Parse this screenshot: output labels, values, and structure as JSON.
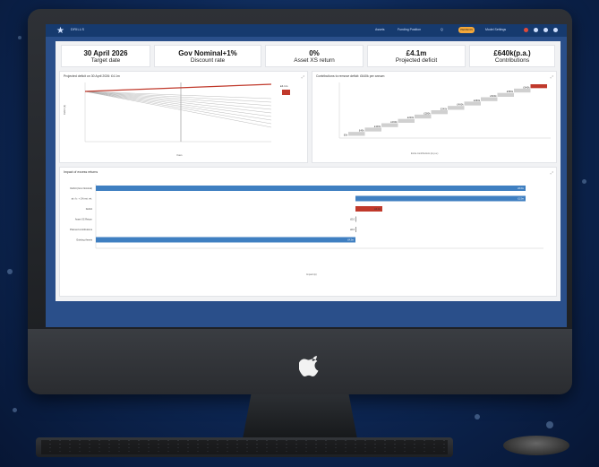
{
  "app": {
    "brand": "DRILLS"
  },
  "nav": [
    "Assets",
    "Funding Position",
    "Q"
  ],
  "badge": "PENSION",
  "topbar_right": "Model Settings",
  "kpis": [
    {
      "value": "30 April 2026",
      "label": "Target date"
    },
    {
      "value": "Gov Nominal+1%",
      "label": "Discount rate"
    },
    {
      "value": "0%",
      "label": "Asset XS return"
    },
    {
      "value": "£4.1m",
      "label": "Projected deficit"
    },
    {
      "value": "£640k(p.a.)",
      "label": "Contributions"
    }
  ],
  "panels": {
    "deficit": {
      "title": "Projected deficit on 30 April 2026: £4.1m",
      "ylabel": "Deficit (£)",
      "xlabel": "Years",
      "marker": "£4.1m"
    },
    "contrib": {
      "title": "Contributions to remove deficit: £640k per annum",
      "xlabel": "Extra contributions (£ p.a.)"
    },
    "excess": {
      "title": "Impact of excess returns",
      "xlabel": "Impact (£)"
    }
  },
  "waterfall_labels": [
    "£640k",
    "£580k",
    "£520k",
    "£460k",
    "£400k",
    "£340k",
    "£280k",
    "£220k",
    "£160k",
    "£100k",
    "£40k",
    "£0k"
  ],
  "excess_rows": [
    {
      "label": "Deficit (Gov Nominal)",
      "value": "£5.6m"
    },
    {
      "label": "at r.f.r. + 1% ext. ret.",
      "value": "£1.5m"
    },
    {
      "label": "Deficit",
      "value": "£4.1m"
    },
    {
      "label": "Asset XS Return",
      "value": "£0.0"
    },
    {
      "label": "Planned contributions",
      "value": "£0.0"
    },
    {
      "label": "Existing Assets",
      "value": "£4.3m"
    }
  ],
  "colors": {
    "accent": "#c0392b",
    "bar": "#3f7fc1",
    "nav": "#163a6e"
  }
}
